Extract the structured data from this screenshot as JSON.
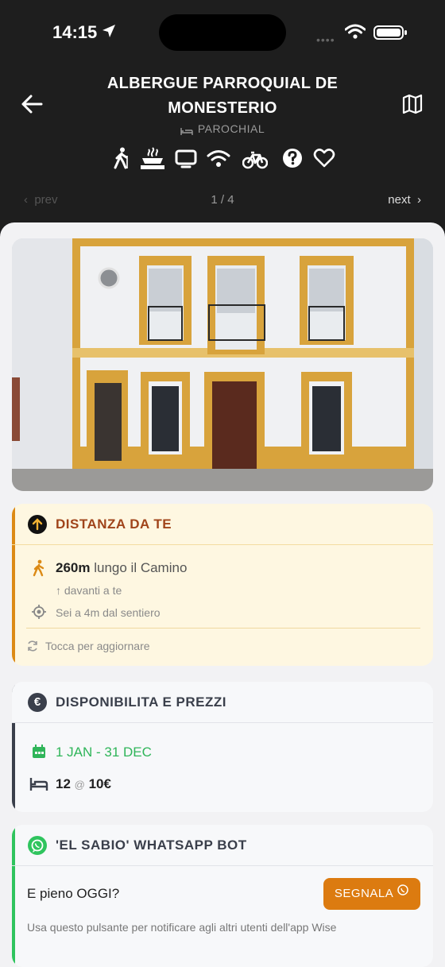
{
  "status": {
    "time": "14:15"
  },
  "header": {
    "title": "ALBERGUE PARROQUIAL DE MONESTERIO",
    "type": "PAROCHIAL",
    "amenities": [
      "hiker-icon",
      "kitchen-icon",
      "tv-icon",
      "wifi-icon",
      "bicycle-icon",
      "help-icon",
      "favorite-heart-icon"
    ]
  },
  "pager": {
    "prev": "prev",
    "page": "1 / 4",
    "next": "next"
  },
  "distance": {
    "title": "DISTANZA DA TE",
    "value": "260m",
    "along": "lungo il Camino",
    "direction": "davanti a te",
    "offtrail": "Sei a 4m dal sentiero",
    "refresh": "Tocca per aggiornare"
  },
  "availability": {
    "title": "DISPONIBILITA E PREZZI",
    "dates": "1 JAN - 31 DEC",
    "beds": "12",
    "at": "@",
    "price": "10€"
  },
  "bot": {
    "title": "'EL SABIO' WHATSAPP BOT",
    "question": "E pieno OGGI?",
    "button": "SEGNALA",
    "note": "Usa questo pulsante per notificare agli altri utenti dell'app Wise"
  },
  "colors": {
    "accent": "#dc8a15",
    "green": "#2fc45e",
    "dark": "#1e1e1e"
  }
}
